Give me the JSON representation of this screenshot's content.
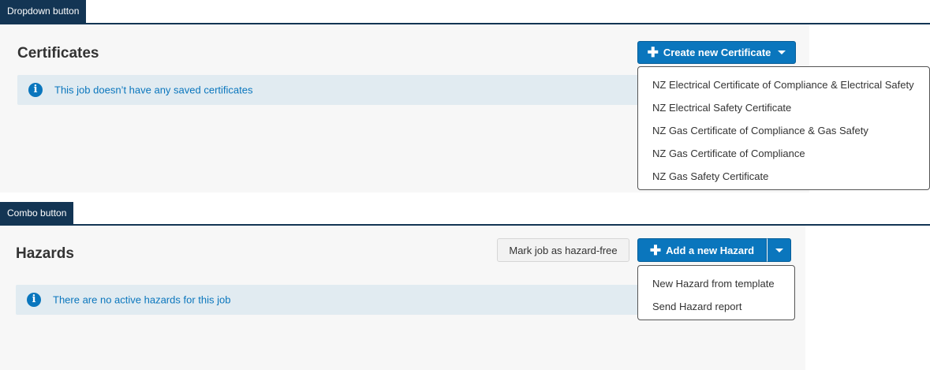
{
  "section1": {
    "tag_label": "Dropdown button",
    "title": "Certificates",
    "info_text": "This job doesn’t have any saved certificates",
    "button_label": "Create new Certificate",
    "menu_items": [
      "NZ Electrical Certificate of Compliance & Electrical Safety",
      "NZ Electrical Safety Certificate",
      "NZ Gas Certificate of Compliance & Gas Safety",
      "NZ Gas Certificate of Compliance",
      "NZ Gas Safety Certificate"
    ]
  },
  "section2": {
    "tag_label": "Combo button",
    "title": "Hazards",
    "info_text": "There are no active hazards for this job",
    "secondary_button_label": "Mark job as hazard-free",
    "primary_button_label": "Add a new Hazard",
    "menu_items": [
      "New Hazard from template",
      "Send Hazard report"
    ]
  },
  "colors": {
    "primary": "#0a76bd",
    "header_tag": "#133554",
    "info_bg": "#e1ebf1",
    "panel_bg": "#f7f7f7"
  },
  "icons": {
    "info": "info-circle-icon",
    "plus": "plus-icon",
    "caret": "caret-down-icon"
  }
}
